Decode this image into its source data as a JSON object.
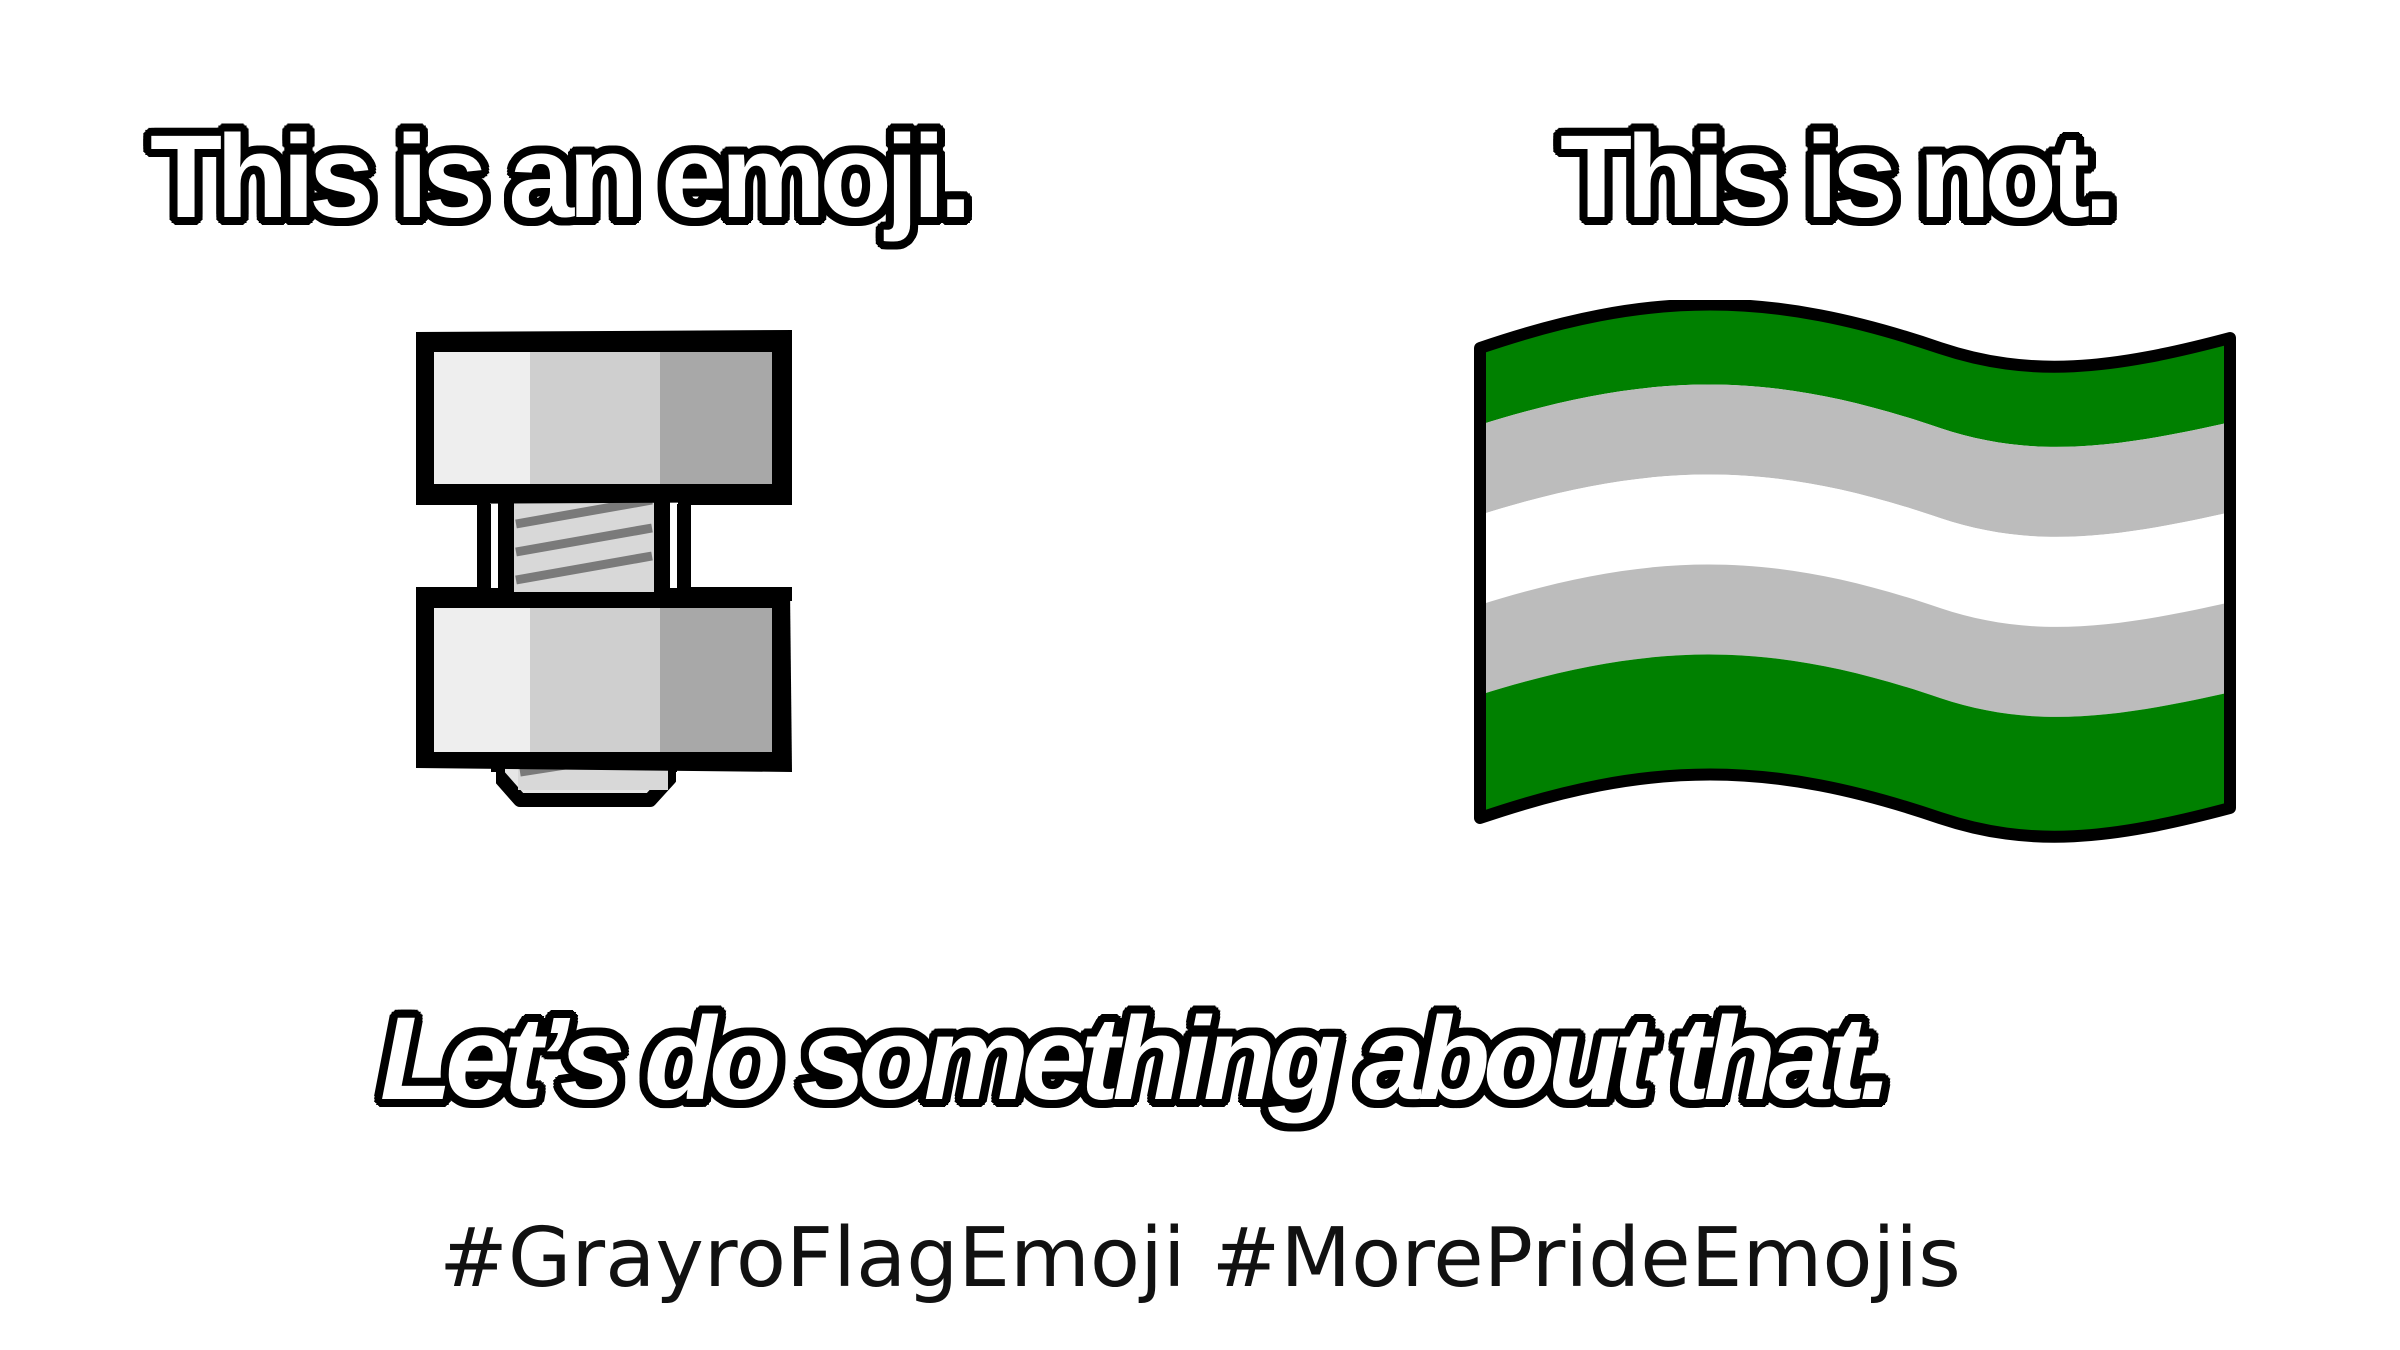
{
  "heading_left": "This is an emoji.",
  "heading_right": "This is not.",
  "tagline": "Let’s do something about that.",
  "hashtags": [
    "#GrayroFlagEmoji",
    "#MorePrideEmojis"
  ],
  "left_image": {
    "icon": "nut-and-bolt-icon"
  },
  "right_image": {
    "icon": "grayro-flag-icon",
    "stripe_colors": [
      "#008000",
      "#bcbcbc",
      "#ffffff",
      "#bcbcbc",
      "#008000"
    ]
  }
}
